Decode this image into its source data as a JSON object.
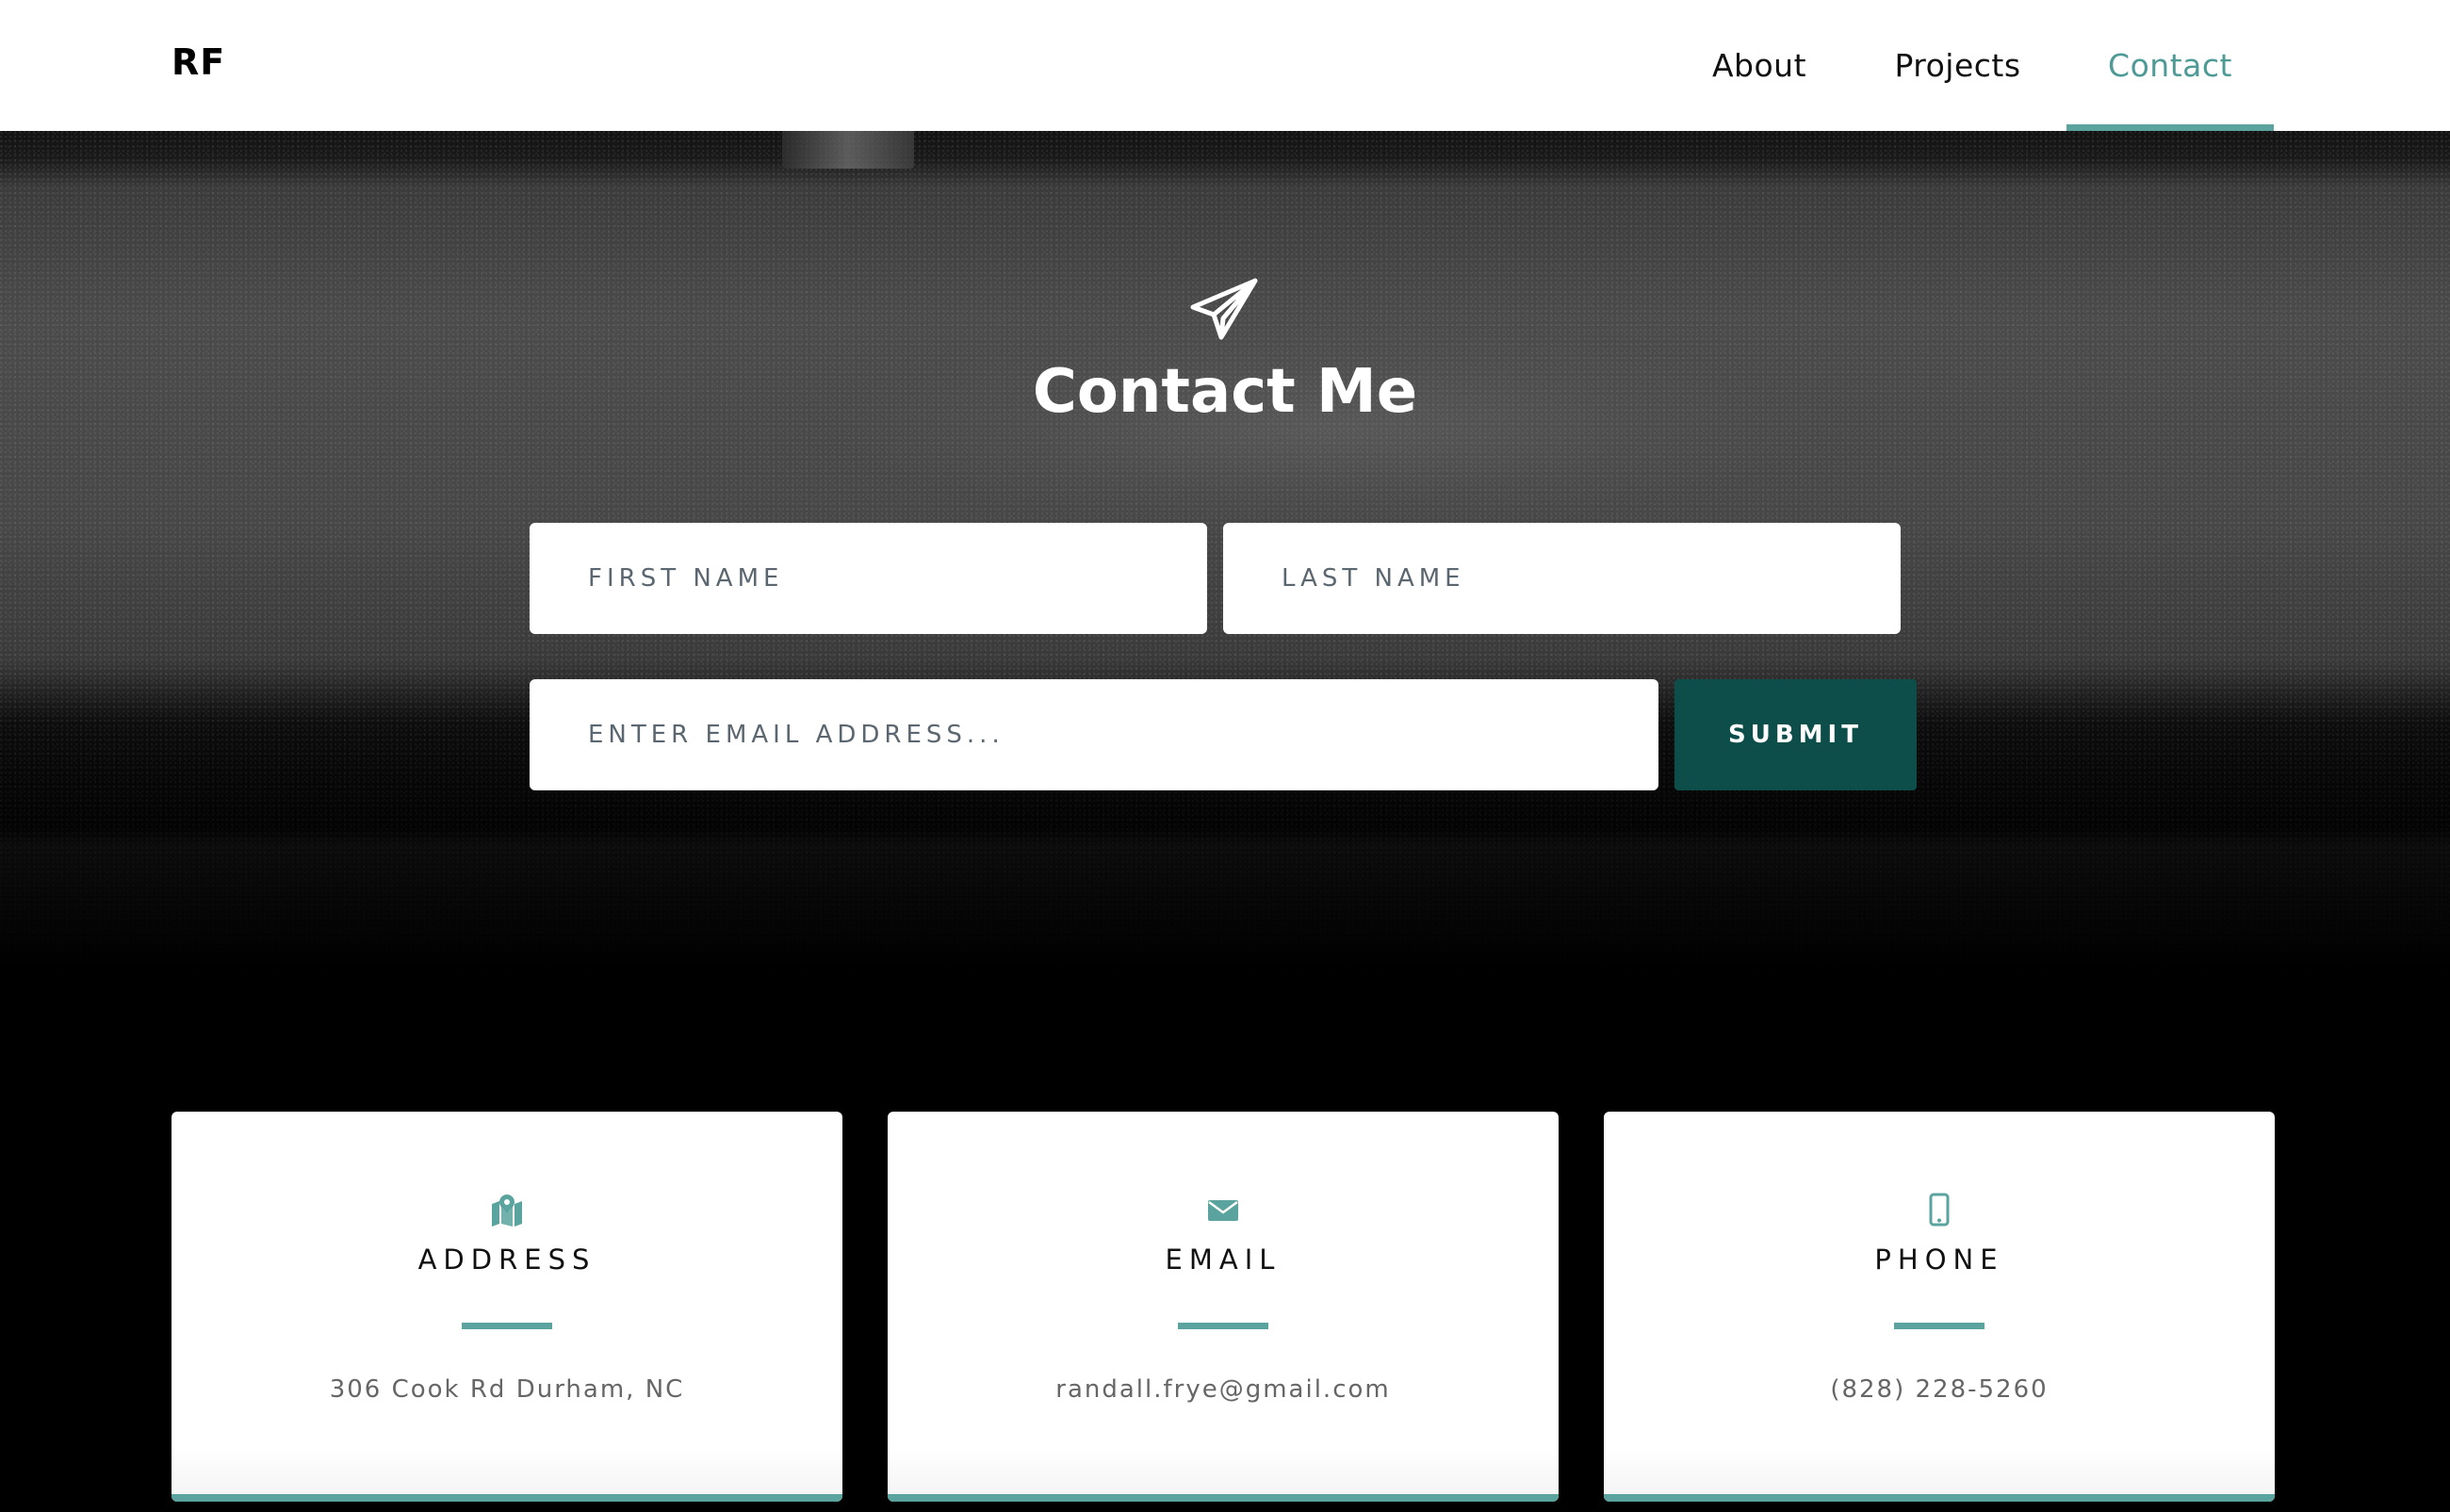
{
  "navbar": {
    "brand": "RF",
    "links": [
      {
        "label": "About"
      },
      {
        "label": "Projects"
      },
      {
        "label": "Contact",
        "active": true
      }
    ]
  },
  "hero": {
    "icon": "paper-plane-icon",
    "title": "Contact Me",
    "form": {
      "first_name_placeholder": "FIRST NAME",
      "last_name_placeholder": "LAST NAME",
      "email_placeholder": "ENTER EMAIL ADDRESS...",
      "submit_label": "SUBMIT"
    }
  },
  "cards": [
    {
      "icon": "map-marker-icon",
      "title": "ADDRESS",
      "value": "306 Cook Rd Durham, NC"
    },
    {
      "icon": "envelope-icon",
      "title": "EMAIL",
      "value": "randall.frye@gmail.com"
    },
    {
      "icon": "mobile-phone-icon",
      "title": "PHONE",
      "value": "(828) 228-5260"
    }
  ],
  "colors": {
    "accent": "#5aa39f",
    "submit_bg": "#0d4d4a",
    "nav_active": "#4e9a97",
    "page_bg": "#000000"
  }
}
